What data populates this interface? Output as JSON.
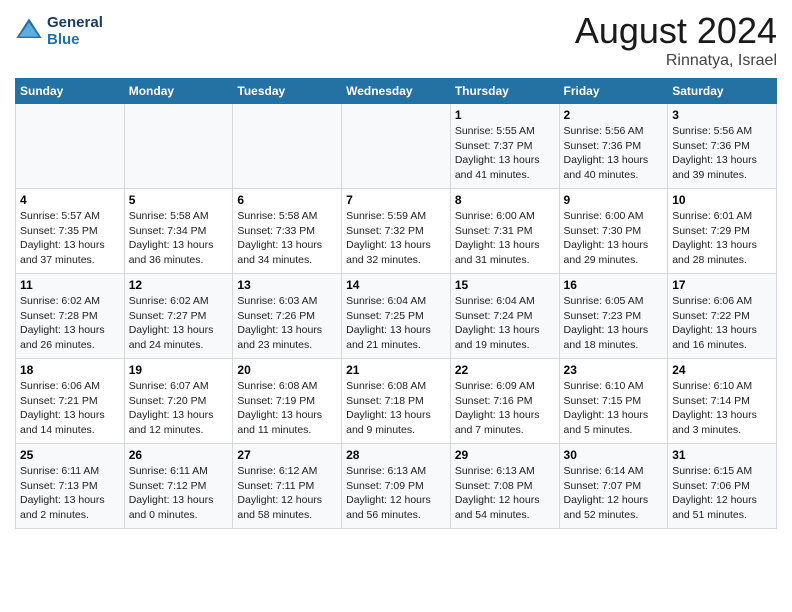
{
  "header": {
    "logo_line1": "General",
    "logo_line2": "Blue",
    "title": "August 2024",
    "subtitle": "Rinnatya, Israel"
  },
  "days_of_week": [
    "Sunday",
    "Monday",
    "Tuesday",
    "Wednesday",
    "Thursday",
    "Friday",
    "Saturday"
  ],
  "weeks": [
    [
      {
        "day": "",
        "info": ""
      },
      {
        "day": "",
        "info": ""
      },
      {
        "day": "",
        "info": ""
      },
      {
        "day": "",
        "info": ""
      },
      {
        "day": "1",
        "info": "Sunrise: 5:55 AM\nSunset: 7:37 PM\nDaylight: 13 hours and 41 minutes."
      },
      {
        "day": "2",
        "info": "Sunrise: 5:56 AM\nSunset: 7:36 PM\nDaylight: 13 hours and 40 minutes."
      },
      {
        "day": "3",
        "info": "Sunrise: 5:56 AM\nSunset: 7:36 PM\nDaylight: 13 hours and 39 minutes."
      }
    ],
    [
      {
        "day": "4",
        "info": "Sunrise: 5:57 AM\nSunset: 7:35 PM\nDaylight: 13 hours and 37 minutes."
      },
      {
        "day": "5",
        "info": "Sunrise: 5:58 AM\nSunset: 7:34 PM\nDaylight: 13 hours and 36 minutes."
      },
      {
        "day": "6",
        "info": "Sunrise: 5:58 AM\nSunset: 7:33 PM\nDaylight: 13 hours and 34 minutes."
      },
      {
        "day": "7",
        "info": "Sunrise: 5:59 AM\nSunset: 7:32 PM\nDaylight: 13 hours and 32 minutes."
      },
      {
        "day": "8",
        "info": "Sunrise: 6:00 AM\nSunset: 7:31 PM\nDaylight: 13 hours and 31 minutes."
      },
      {
        "day": "9",
        "info": "Sunrise: 6:00 AM\nSunset: 7:30 PM\nDaylight: 13 hours and 29 minutes."
      },
      {
        "day": "10",
        "info": "Sunrise: 6:01 AM\nSunset: 7:29 PM\nDaylight: 13 hours and 28 minutes."
      }
    ],
    [
      {
        "day": "11",
        "info": "Sunrise: 6:02 AM\nSunset: 7:28 PM\nDaylight: 13 hours and 26 minutes."
      },
      {
        "day": "12",
        "info": "Sunrise: 6:02 AM\nSunset: 7:27 PM\nDaylight: 13 hours and 24 minutes."
      },
      {
        "day": "13",
        "info": "Sunrise: 6:03 AM\nSunset: 7:26 PM\nDaylight: 13 hours and 23 minutes."
      },
      {
        "day": "14",
        "info": "Sunrise: 6:04 AM\nSunset: 7:25 PM\nDaylight: 13 hours and 21 minutes."
      },
      {
        "day": "15",
        "info": "Sunrise: 6:04 AM\nSunset: 7:24 PM\nDaylight: 13 hours and 19 minutes."
      },
      {
        "day": "16",
        "info": "Sunrise: 6:05 AM\nSunset: 7:23 PM\nDaylight: 13 hours and 18 minutes."
      },
      {
        "day": "17",
        "info": "Sunrise: 6:06 AM\nSunset: 7:22 PM\nDaylight: 13 hours and 16 minutes."
      }
    ],
    [
      {
        "day": "18",
        "info": "Sunrise: 6:06 AM\nSunset: 7:21 PM\nDaylight: 13 hours and 14 minutes."
      },
      {
        "day": "19",
        "info": "Sunrise: 6:07 AM\nSunset: 7:20 PM\nDaylight: 13 hours and 12 minutes."
      },
      {
        "day": "20",
        "info": "Sunrise: 6:08 AM\nSunset: 7:19 PM\nDaylight: 13 hours and 11 minutes."
      },
      {
        "day": "21",
        "info": "Sunrise: 6:08 AM\nSunset: 7:18 PM\nDaylight: 13 hours and 9 minutes."
      },
      {
        "day": "22",
        "info": "Sunrise: 6:09 AM\nSunset: 7:16 PM\nDaylight: 13 hours and 7 minutes."
      },
      {
        "day": "23",
        "info": "Sunrise: 6:10 AM\nSunset: 7:15 PM\nDaylight: 13 hours and 5 minutes."
      },
      {
        "day": "24",
        "info": "Sunrise: 6:10 AM\nSunset: 7:14 PM\nDaylight: 13 hours and 3 minutes."
      }
    ],
    [
      {
        "day": "25",
        "info": "Sunrise: 6:11 AM\nSunset: 7:13 PM\nDaylight: 13 hours and 2 minutes."
      },
      {
        "day": "26",
        "info": "Sunrise: 6:11 AM\nSunset: 7:12 PM\nDaylight: 13 hours and 0 minutes."
      },
      {
        "day": "27",
        "info": "Sunrise: 6:12 AM\nSunset: 7:11 PM\nDaylight: 12 hours and 58 minutes."
      },
      {
        "day": "28",
        "info": "Sunrise: 6:13 AM\nSunset: 7:09 PM\nDaylight: 12 hours and 56 minutes."
      },
      {
        "day": "29",
        "info": "Sunrise: 6:13 AM\nSunset: 7:08 PM\nDaylight: 12 hours and 54 minutes."
      },
      {
        "day": "30",
        "info": "Sunrise: 6:14 AM\nSunset: 7:07 PM\nDaylight: 12 hours and 52 minutes."
      },
      {
        "day": "31",
        "info": "Sunrise: 6:15 AM\nSunset: 7:06 PM\nDaylight: 12 hours and 51 minutes."
      }
    ]
  ]
}
